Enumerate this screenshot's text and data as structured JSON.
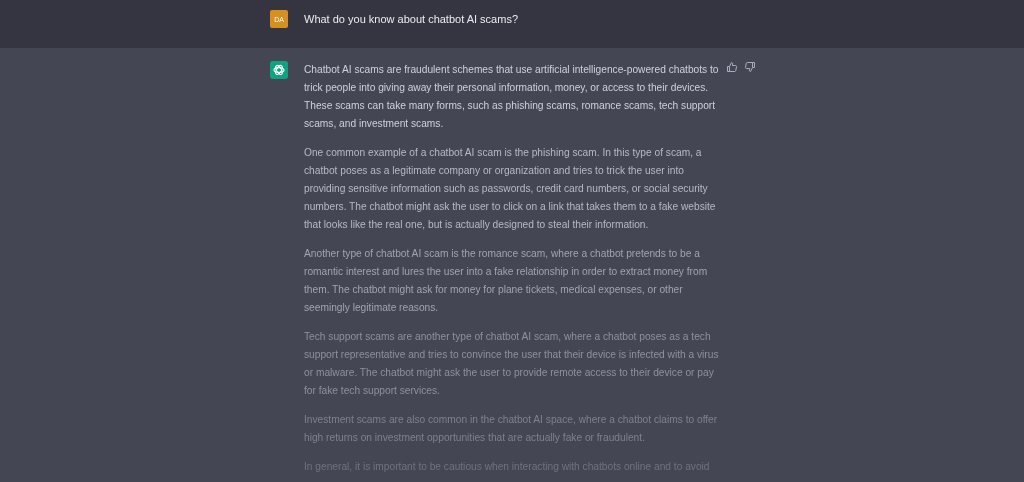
{
  "user_message": {
    "avatar": "DA",
    "text": "What do you know about chatbot AI scams?"
  },
  "assistant_message": {
    "paragraphs": [
      "Chatbot AI scams are fraudulent schemes that use artificial intelligence-powered chatbots to trick people into giving away their personal information, money, or access to their devices. These scams can take many forms, such as phishing scams, romance scams, tech support scams, and investment scams.",
      "One common example of a chatbot AI scam is the phishing scam. In this type of scam, a chatbot poses as a legitimate company or organization and tries to trick the user into providing sensitive information such as passwords, credit card numbers, or social security numbers. The chatbot might ask the user to click on a link that takes them to a fake website that looks like the real one, but is actually designed to steal their information.",
      "Another type of chatbot AI scam is the romance scam, where a chatbot pretends to be a romantic interest and lures the user into a fake relationship in order to extract money from them. The chatbot might ask for money for plane tickets, medical expenses, or other seemingly legitimate reasons.",
      "Tech support scams are another type of chatbot AI scam, where a chatbot poses as a tech support representative and tries to convince the user that their device is infected with a virus or malware. The chatbot might ask the user to provide remote access to their device or pay for fake tech support services.",
      "Investment scams are also common in the chatbot AI space, where a chatbot claims to offer high returns on investment opportunities that are actually fake or fraudulent.",
      "In general, it is important to be cautious when interacting with chatbots online and to avoid"
    ]
  }
}
